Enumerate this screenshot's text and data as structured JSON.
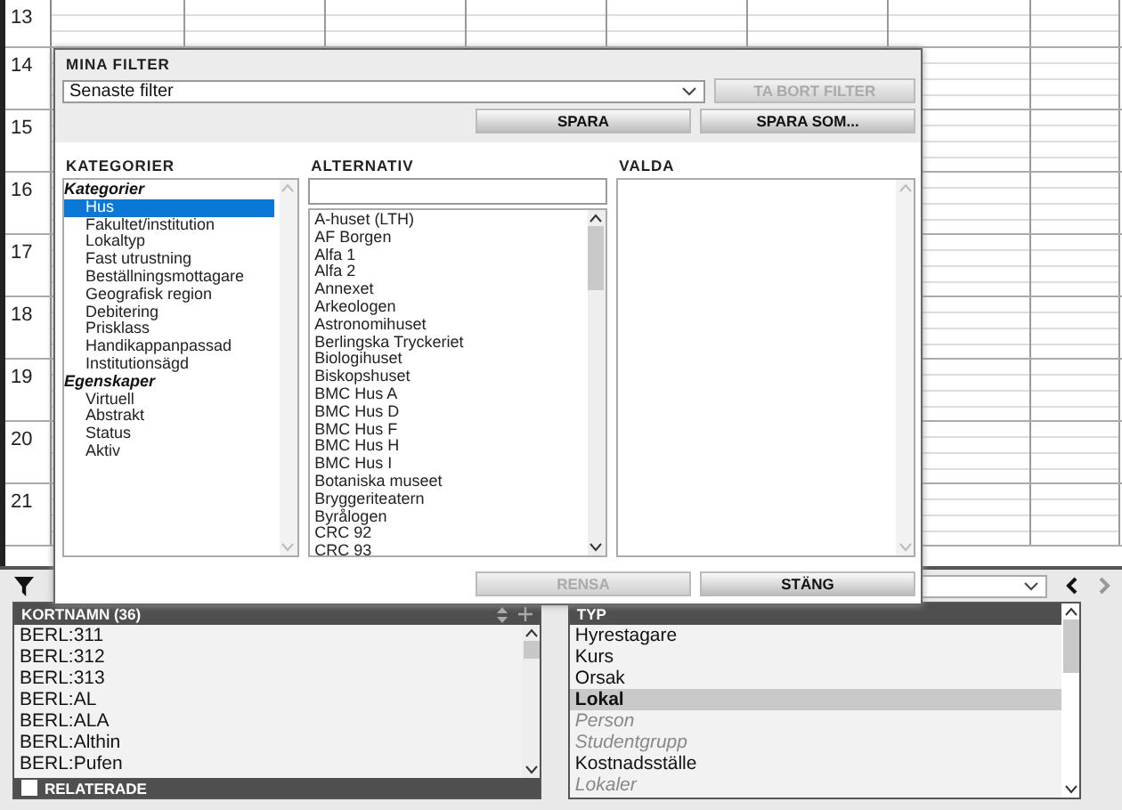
{
  "spreadsheet": {
    "row_numbers": [
      "13",
      "14",
      "15",
      "16",
      "17",
      "18",
      "19",
      "20",
      "21"
    ]
  },
  "dialog": {
    "title": "MINA FILTER",
    "filter_select": {
      "value": "Senaste filter"
    },
    "remove_button": {
      "label": "TA BORT FILTER",
      "disabled": true
    },
    "save_buttons": [
      {
        "label": "SPARA",
        "disabled": false
      },
      {
        "label": "SPARA SOM...",
        "disabled": false
      }
    ],
    "categories": {
      "heading": "KATEGORIER",
      "groups": [
        {
          "label": "Kategorier",
          "children": [
            {
              "label": "Hus",
              "selected": true
            },
            {
              "label": "Fakultet/institution",
              "selected": false
            },
            {
              "label": "Lokaltyp",
              "selected": false
            },
            {
              "label": "Fast utrustning",
              "selected": false
            },
            {
              "label": "Beställningsmottagare",
              "selected": false
            },
            {
              "label": "Geografisk region",
              "selected": false
            },
            {
              "label": "Debitering",
              "selected": false
            },
            {
              "label": "Prisklass",
              "selected": false
            },
            {
              "label": "Handikappanpassad",
              "selected": false
            },
            {
              "label": "Institutionsägd",
              "selected": false
            }
          ]
        },
        {
          "label": "Egenskaper",
          "children": [
            {
              "label": "Virtuell",
              "selected": false
            },
            {
              "label": "Abstrakt",
              "selected": false
            },
            {
              "label": "Status",
              "selected": false
            },
            {
              "label": "Aktiv",
              "selected": false
            }
          ]
        }
      ]
    },
    "alternatives": {
      "heading": "ALTERNATIV",
      "items": [
        "A-huset (LTH)",
        "AF Borgen",
        "Alfa 1",
        "Alfa 2",
        "Annexet",
        "Arkeologen",
        "Astronomihuset",
        "Berlingska Tryckeriet",
        "Biologihuset",
        "Biskopshuset",
        "BMC Hus A",
        "BMC Hus D",
        "BMC Hus F",
        "BMC Hus H",
        "BMC Hus I",
        "Botaniska museet",
        "Bryggeriteatern",
        "Byrålogen",
        "CRC 92",
        "CRC 93"
      ]
    },
    "selected_panel": {
      "heading": "VALDA"
    },
    "footer_buttons": [
      {
        "label": "RENSA",
        "disabled": true
      },
      {
        "label": "STÄNG",
        "disabled": false
      }
    ]
  },
  "short_names": {
    "heading": "KORTNAMN (36)",
    "items": [
      "BERL:311",
      "BERL:312",
      "BERL:313",
      "BERL:AL",
      "BERL:ALA",
      "BERL:Althin",
      "BERL:Pufen"
    ],
    "related": {
      "label": "RELATERADE",
      "checked": false
    }
  },
  "types": {
    "heading": "TYP",
    "items": [
      {
        "label": "Hyrestagare",
        "selected": false,
        "disabled": false
      },
      {
        "label": "Kurs",
        "selected": false,
        "disabled": false
      },
      {
        "label": "Orsak",
        "selected": false,
        "disabled": false
      },
      {
        "label": "Lokal",
        "selected": true,
        "disabled": false
      },
      {
        "label": "Person",
        "selected": false,
        "disabled": true
      },
      {
        "label": "Studentgrupp",
        "selected": false,
        "disabled": true
      },
      {
        "label": "Kostnadsställe",
        "selected": false,
        "disabled": false
      },
      {
        "label": "Lokaler",
        "selected": false,
        "disabled": true
      }
    ]
  }
}
